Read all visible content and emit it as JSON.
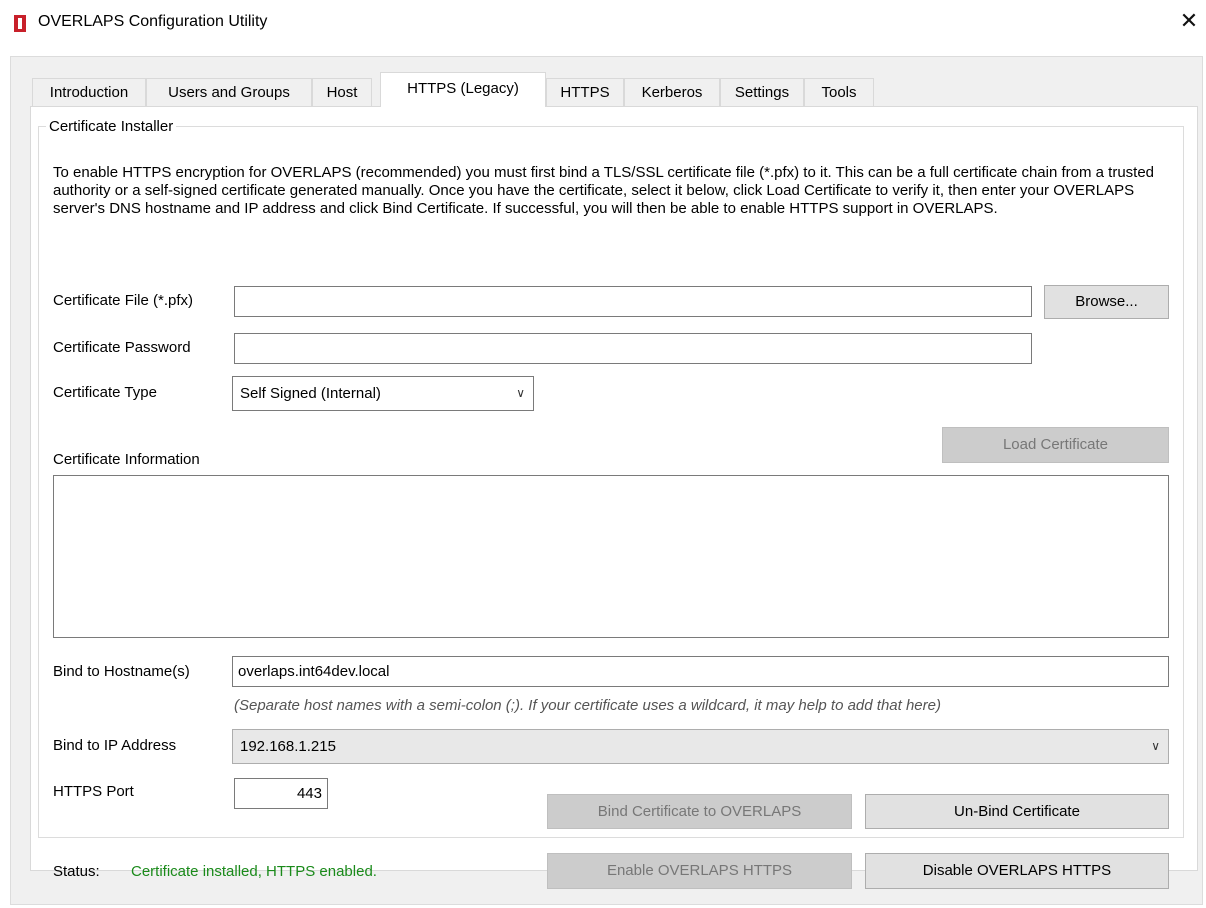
{
  "window": {
    "title": "OVERLAPS Configuration Utility",
    "close_glyph": "✕"
  },
  "tabs": [
    {
      "label": "Introduction",
      "active": false
    },
    {
      "label": "Users and Groups",
      "active": false
    },
    {
      "label": "Host",
      "active": false
    },
    {
      "label": "HTTPS (Legacy)",
      "active": true
    },
    {
      "label": "HTTPS",
      "active": false
    },
    {
      "label": "Kerberos",
      "active": false
    },
    {
      "label": "Settings",
      "active": false
    },
    {
      "label": "Tools",
      "active": false
    }
  ],
  "installer": {
    "group_label": "Certificate Installer",
    "description": "To enable HTTPS encryption for OVERLAPS (recommended) you must first bind a TLS/SSL certificate file (*.pfx) to it. This can be a full certificate chain from a trusted authority or a self-signed certificate generated manually. Once you have the certificate, select it below, click Load Certificate to verify it, then enter your OVERLAPS server's DNS hostname and IP address and click Bind Certificate. If successful, you will then be able to enable HTTPS support in OVERLAPS.",
    "cert_file_label": "Certificate File (*.pfx)",
    "cert_file_value": "",
    "browse_label": "Browse...",
    "cert_password_label": "Certificate Password",
    "cert_password_value": "",
    "cert_type_label": "Certificate Type",
    "cert_type_value": "Self Signed (Internal)",
    "load_cert_label": "Load Certificate",
    "cert_info_label": "Certificate Information",
    "cert_info_value": "",
    "hostname_label": "Bind to Hostname(s)",
    "hostname_value": "overlaps.int64dev.local",
    "hostname_hint": "(Separate host names with a semi-colon (;). If your certificate uses a wildcard, it may help to add that here)",
    "ip_label": "Bind to IP Address",
    "ip_value": "192.168.1.215",
    "port_label": "HTTPS Port",
    "port_value": "443",
    "bind_label": "Bind Certificate to OVERLAPS",
    "unbind_label": "Un-Bind Certificate"
  },
  "status": {
    "label": "Status:",
    "text": "Certificate installed, HTTPS enabled.",
    "color": "#1a8a1a"
  },
  "footer": {
    "enable_label": "Enable OVERLAPS HTTPS",
    "disable_label": "Disable OVERLAPS HTTPS"
  }
}
